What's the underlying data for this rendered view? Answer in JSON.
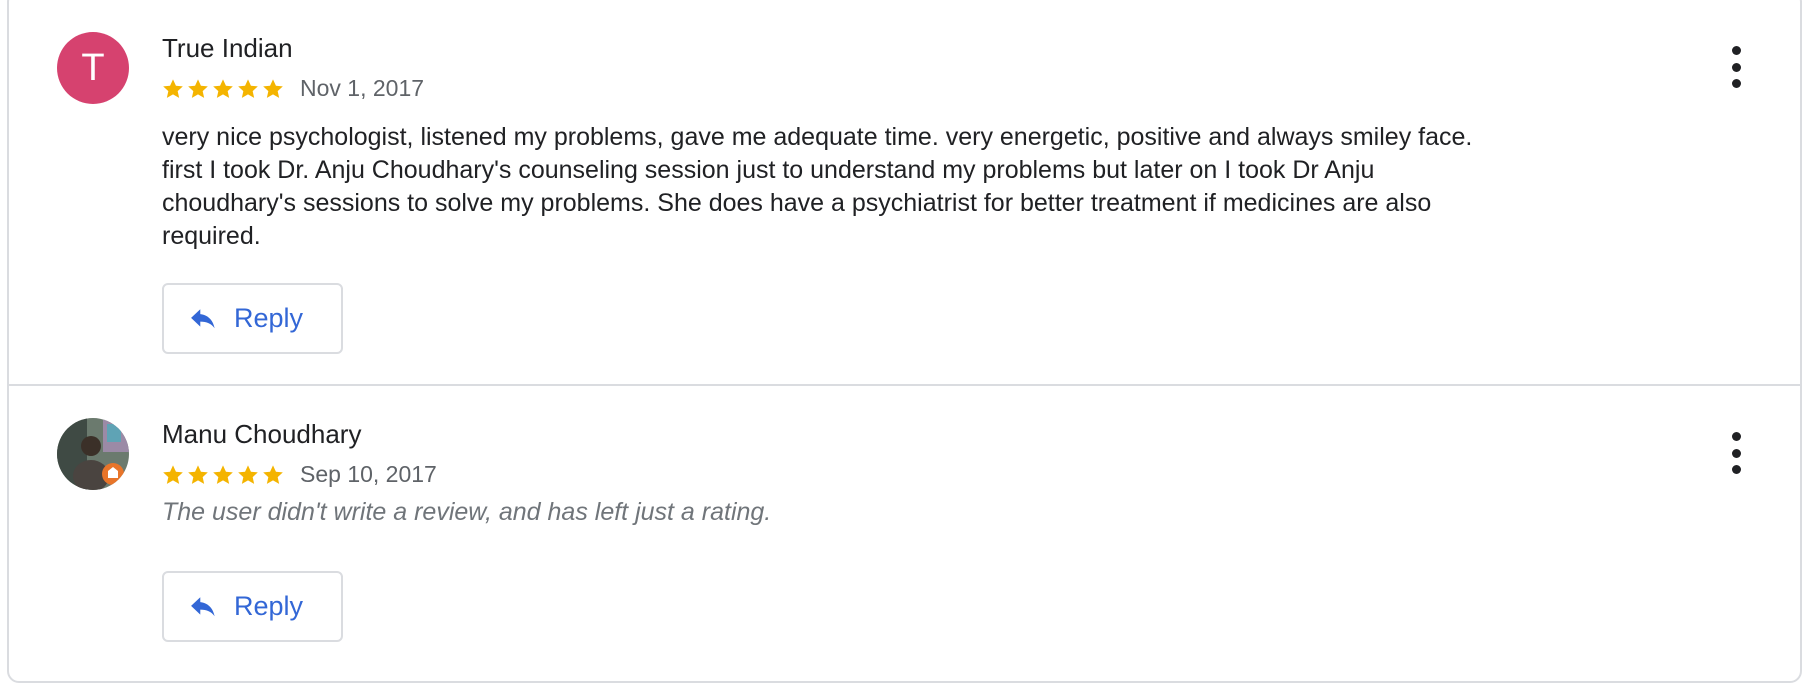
{
  "reviews": [
    {
      "author": "True Indian",
      "avatar_letter": "T",
      "avatar_color": "#d6426f",
      "rating": 5,
      "date": "Nov 1, 2017",
      "text_lines": [
        "very nice psychologist, listened my problems, gave me adequate time. very energetic, positive and always smiley face.",
        "first I took Dr. Anju Choudhary's counseling session just to understand my problems but later on I took Dr Anju",
        "choudhary's sessions to solve my problems. She does have a psychiatrist for better treatment if medicines are also",
        "required."
      ],
      "reply_label": "Reply",
      "more_icon": "more-vert-icon"
    },
    {
      "author": "Manu Choudhary",
      "avatar_type": "photo",
      "rating": 5,
      "date": "Sep 10, 2017",
      "no_text_notice": "The user didn't write a review, and has left just a rating.",
      "reply_label": "Reply",
      "more_icon": "more-vert-icon"
    }
  ],
  "colors": {
    "star": "#f4b400",
    "reply_text": "#3367d6",
    "divider": "#dadce0",
    "secondary_text": "#5f6368",
    "italic_notice": "#70757a"
  },
  "icons": {
    "star": "star-icon",
    "reply": "reply-icon",
    "more": "more-vert-icon"
  }
}
